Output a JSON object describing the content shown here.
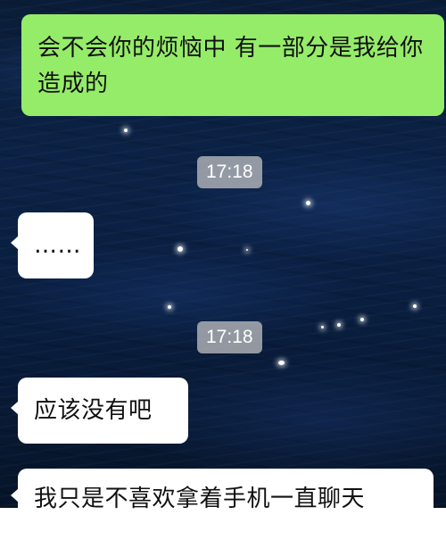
{
  "messages": [
    {
      "direction": "sent",
      "text": "会不会你的烦恼中 有一部分是我给你造成的"
    },
    {
      "direction": "received",
      "text": "……"
    },
    {
      "direction": "received",
      "text": "应该没有吧"
    },
    {
      "direction": "received",
      "text": "我只是不喜欢拿着手机一直聊天"
    }
  ],
  "timestamps": [
    "17:18",
    "17:18"
  ],
  "colors": {
    "sent_bubble": "#95ec69",
    "received_bubble": "#ffffff",
    "timestamp_bg": "#c8c8c8",
    "background": "#0b2246"
  }
}
